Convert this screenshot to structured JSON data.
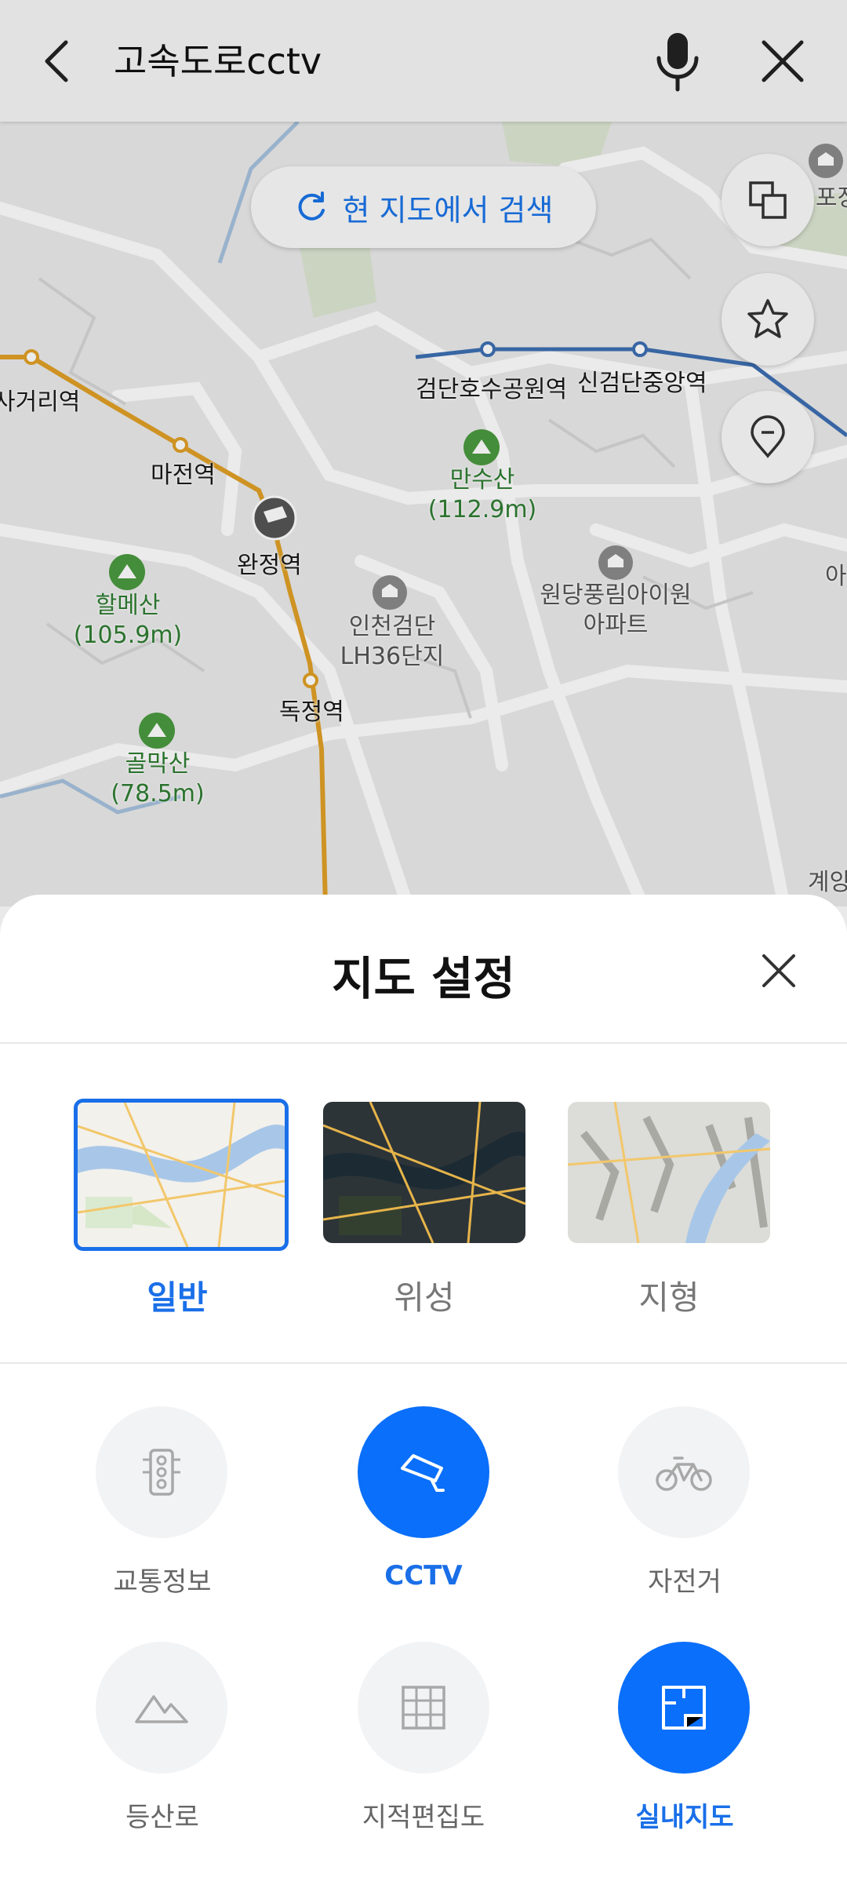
{
  "search": {
    "query": "고속도로cctv"
  },
  "icons": {
    "back": "chevron-left-icon",
    "mic": "microphone-icon",
    "close": "close-icon"
  },
  "map": {
    "research_label": "현 지도에서 검색",
    "stations": [
      "검단호수공원역",
      "신검단중앙역",
      "마전역",
      "완정역",
      "독정역",
      "사거리역"
    ],
    "mountains": [
      {
        "name": "만수산",
        "elev": "(112.9m)"
      },
      {
        "name": "할메산",
        "elev": "(105.9m)"
      },
      {
        "name": "골막산",
        "elev": "(78.5m)"
      }
    ],
    "places": [
      {
        "line1": "인천검단",
        "line2": "LH36단지"
      },
      {
        "line1": "원당풍림아이원",
        "line2": "아파트"
      }
    ],
    "edge_labels": {
      "top_right": "포장",
      "mid_right": "아",
      "bottom_right": "계양"
    }
  },
  "sheet": {
    "title": "지도 설정",
    "map_types": [
      {
        "label": "일반",
        "active": true
      },
      {
        "label": "위성",
        "active": false
      },
      {
        "label": "지형",
        "active": false
      }
    ],
    "layers": [
      {
        "label": "교통정보",
        "icon": "traffic-light-icon",
        "active": false
      },
      {
        "label": "CCTV",
        "icon": "cctv-camera-icon",
        "active": true
      },
      {
        "label": "자전거",
        "icon": "bicycle-icon",
        "active": false
      },
      {
        "label": "등산로",
        "icon": "mountain-icon",
        "active": false
      },
      {
        "label": "지적편집도",
        "icon": "grid-icon",
        "active": false
      },
      {
        "label": "실내지도",
        "icon": "floorplan-icon",
        "active": true
      }
    ]
  },
  "colors": {
    "accent": "#0a6ffa",
    "accent_text": "#1a6fe8",
    "inactive_circle": "#f2f3f5"
  }
}
